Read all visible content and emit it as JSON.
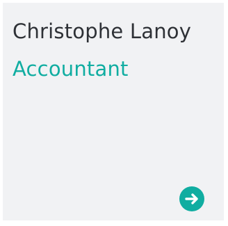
{
  "card": {
    "name": "Christophe Lanoy",
    "role": "Accountant",
    "link_icon": "arrow-right-icon"
  },
  "colors": {
    "accent": "#10ada1",
    "card_background": "#f1f2f4",
    "name_text": "#2e3136"
  }
}
